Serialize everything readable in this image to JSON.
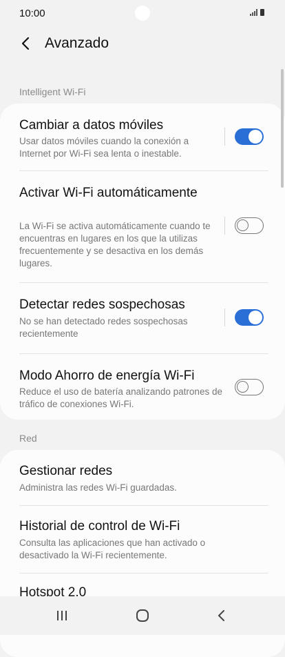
{
  "status_bar": {
    "time": "10:00"
  },
  "header": {
    "title": "Avanzado"
  },
  "sections": {
    "intelligent": {
      "label": "Intelligent Wi-Fi"
    },
    "red": {
      "label": "Red"
    }
  },
  "intelligent_items": [
    {
      "title": "Cambiar a datos móviles",
      "desc": "Usar datos móviles cuando la conexión a Internet por Wi-Fi sea lenta o inestable.",
      "toggle": "on"
    },
    {
      "title": "Activar Wi-Fi automáticamente",
      "desc": "La Wi-Fi se activa automáticamente cuando te encuentras en lugares en los que la utilizas frecuentemente y se desactiva en los demás lugares.",
      "toggle": "off"
    },
    {
      "title": "Detectar redes sospechosas",
      "desc": "No se han detectado redes sospechosas recientemente",
      "toggle": "on"
    },
    {
      "title": "Modo Ahorro de energía Wi-Fi",
      "desc": "Reduce el uso de batería analizando patrones de tráfico de conexiones Wi-Fi.",
      "toggle": "off"
    }
  ],
  "red_items": [
    {
      "title": "Gestionar redes",
      "desc": "Administra las redes Wi-Fi guardadas."
    },
    {
      "title": "Historial de control de Wi-Fi",
      "desc": "Consulta las aplicaciones que han activado o desactivado la Wi-Fi recientemente."
    },
    {
      "title": "Hotspot 2.0"
    }
  ],
  "colors": {
    "accent": "#2a6fd6",
    "background": "#f2f2f2",
    "card": "#fcfcfc"
  },
  "icons": {
    "back": "chevron-left-icon",
    "nav_recent": "recent-apps-icon",
    "nav_home": "home-icon",
    "nav_back": "back-nav-icon"
  }
}
